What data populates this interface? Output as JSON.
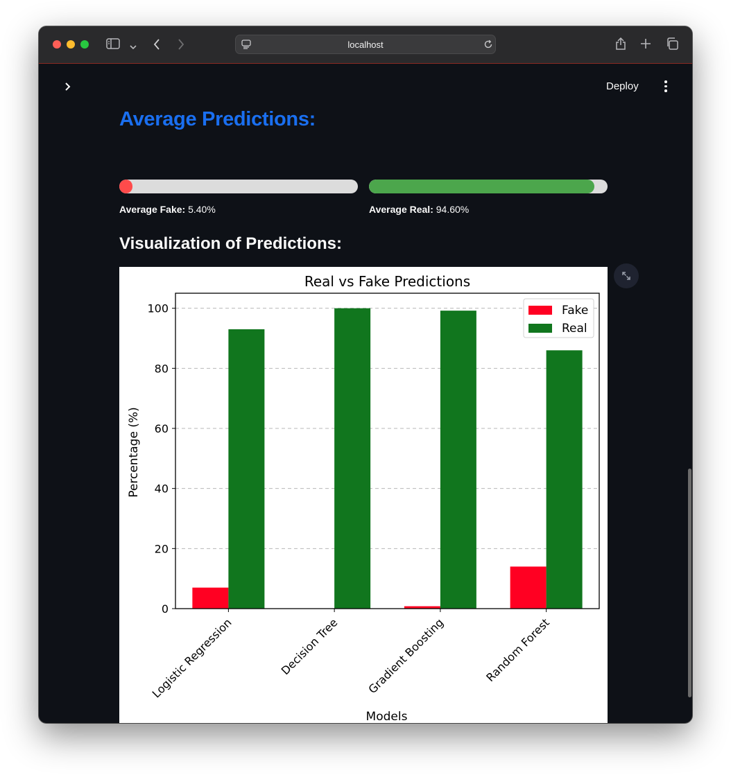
{
  "browser": {
    "url": "localhost"
  },
  "header": {
    "deploy_label": "Deploy"
  },
  "main": {
    "avg_heading": "Average Predictions:",
    "fake": {
      "label": "Average Fake:",
      "value_text": "5.40%",
      "fraction": 0.054,
      "color": "#ff4b4b"
    },
    "real": {
      "label": "Average Real:",
      "value_text": "94.60%",
      "fraction": 0.946,
      "color": "#4ca64c"
    },
    "vis_heading": "Visualization of Predictions:"
  },
  "chart_data": {
    "type": "bar",
    "title": "Real vs Fake Predictions",
    "xlabel": "Models",
    "ylabel": "Percentage (%)",
    "categories": [
      "Logistic Regression",
      "Decision Tree",
      "Gradient Boosting",
      "Random Forest"
    ],
    "series": [
      {
        "name": "Fake",
        "color": "#ff0022",
        "values": [
          7,
          0,
          0.8,
          14
        ]
      },
      {
        "name": "Real",
        "color": "#11761e",
        "values": [
          93,
          100,
          99.2,
          86
        ]
      }
    ],
    "ylim": [
      0,
      105
    ],
    "yticks": [
      0,
      20,
      40,
      60,
      80,
      100
    ],
    "grid": "y-dashed",
    "legend": "top-right"
  }
}
